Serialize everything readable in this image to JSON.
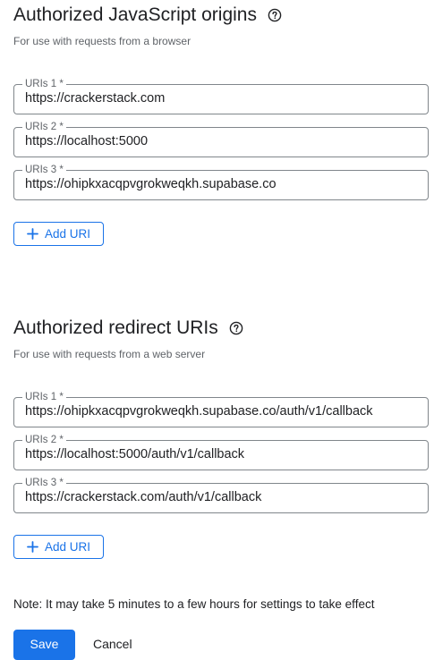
{
  "js_origins": {
    "title": "Authorized JavaScript origins",
    "subtitle": "For use with requests from a browser",
    "uris": [
      {
        "label": "URIs 1 *",
        "value": "https://crackerstack.com"
      },
      {
        "label": "URIs 2 *",
        "value": "https://localhost:5000"
      },
      {
        "label": "URIs 3 *",
        "value": "https://ohipkxacqpvgrokweqkh.supabase.co"
      }
    ],
    "add_label": "Add URI"
  },
  "redirect_uris": {
    "title": "Authorized redirect URIs",
    "subtitle": "For use with requests from a web server",
    "uris": [
      {
        "label": "URIs 1 *",
        "value": "https://ohipkxacqpvgrokweqkh.supabase.co/auth/v1/callback"
      },
      {
        "label": "URIs 2 *",
        "value": "https://localhost:5000/auth/v1/callback"
      },
      {
        "label": "URIs 3 *",
        "value": "https://crackerstack.com/auth/v1/callback"
      }
    ],
    "add_label": "Add URI"
  },
  "note": "Note: It may take 5 minutes to a few hours for settings to take effect",
  "actions": {
    "save_label": "Save",
    "cancel_label": "Cancel"
  },
  "colors": {
    "accent": "#1a73e8",
    "border": "#80868b",
    "muted_text": "#5f6368"
  },
  "icons": {
    "help": "help-circle-icon",
    "add": "plus-icon"
  }
}
